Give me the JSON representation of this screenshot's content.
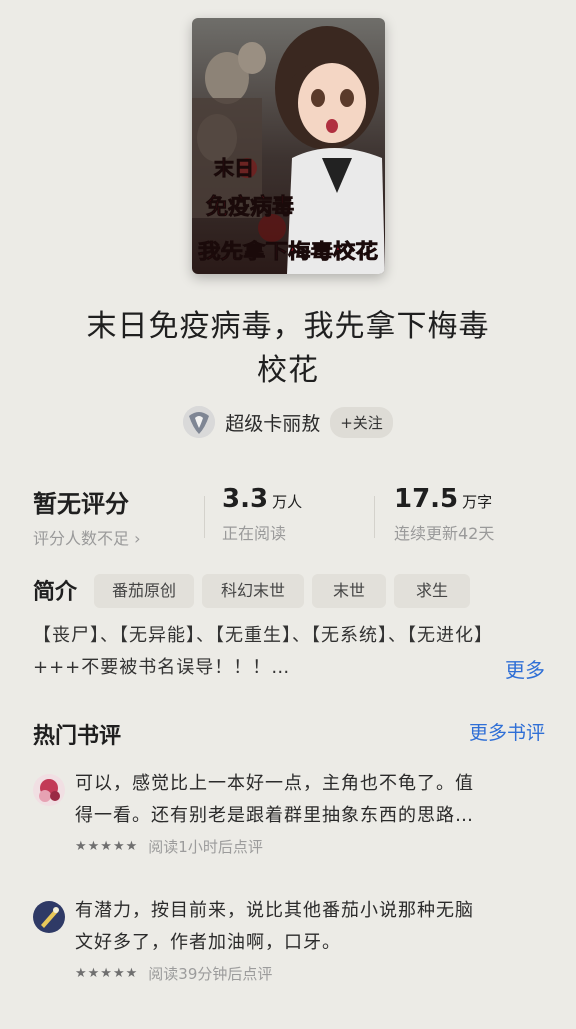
{
  "book": {
    "title_line1": "末日免疫病毒，我先拿下梅毒",
    "title_line2": "校花",
    "cover_text_line1": "末日",
    "cover_text_line2": "免疫病毒",
    "cover_text_line3": "我先拿下梅毒校花"
  },
  "author": {
    "name": "超级卡丽敖",
    "follow_label": "+关注"
  },
  "stats": {
    "rating_main": "暂无评分",
    "rating_sub": "评分人数不足 ›",
    "readers_value": "3.3",
    "readers_unit": "万人",
    "readers_sub": "正在阅读",
    "words_value": "17.5",
    "words_unit": "万字",
    "words_sub": "连续更新42天"
  },
  "intro": {
    "label": "简介",
    "tags": [
      "番茄原创",
      "科幻末世",
      "末世",
      "求生"
    ],
    "line1": "【丧尸】、【无异能】、【无重生】、【无系统】、【无进化】",
    "line2": "+++不要被书名误导！！！…",
    "more_label": "更多"
  },
  "reviews_section": {
    "title": "热门书评",
    "more_label": "更多书评"
  },
  "reviews": [
    {
      "line1": "可以，感觉比上一本好一点，主角也不龟了。值",
      "line2": "得一看。还有别老是跟着群里抽象东西的思路…",
      "stars": "★★★★★",
      "meta": "阅读1小时后点评"
    },
    {
      "line1": "有潜力，按目前来，说比其他番茄小说那种无脑",
      "line2": "文好多了，作者加油啊，口牙。",
      "stars": "★★★★★",
      "meta": "阅读39分钟后点评"
    }
  ],
  "colors": {
    "background": "#ecebe6",
    "link": "#2f6fd6",
    "cover_title": "#b3122a"
  }
}
